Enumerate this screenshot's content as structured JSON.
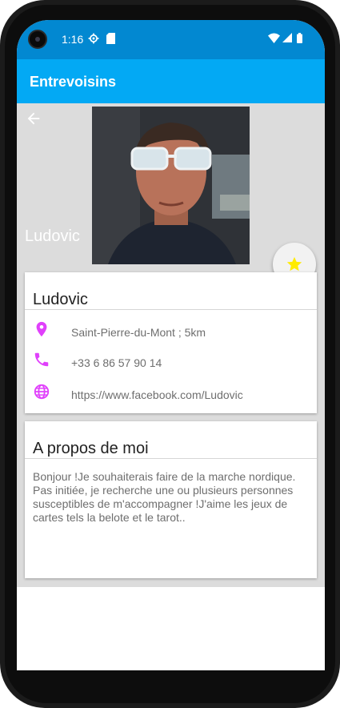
{
  "status_bar": {
    "time": "1:16",
    "icons": [
      "settings-icon",
      "sd-card-icon",
      "wifi-icon",
      "signal-icon",
      "battery-icon"
    ]
  },
  "app_bar": {
    "title": "Entrevoisins"
  },
  "profile": {
    "name_overlay": "Ludovic",
    "photo_icon": "profile-photo",
    "favorite_icon": "star-icon"
  },
  "info_card": {
    "name": "Ludovic",
    "address": "Saint-Pierre-du-Mont ; 5km",
    "phone": "+33 6 86 57 90 14",
    "website": "https://www.facebook.com/Ludovic"
  },
  "about_card": {
    "title": "A propos de moi",
    "text": "Bonjour !Je souhaiterais faire de la marche nordique. Pas initiée, je recherche une ou plusieurs personnes susceptibles de m'accompagner !J'aime les jeux de cartes tels la belote et le tarot.."
  },
  "colors": {
    "status_bar": "#0288d1",
    "app_bar": "#03a9f4",
    "accent_icons": "#e040fb",
    "star": "#ffeb00"
  }
}
